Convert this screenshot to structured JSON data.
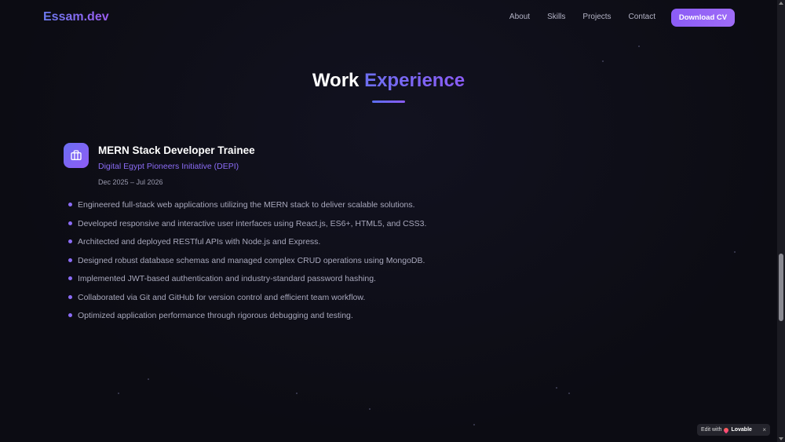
{
  "nav": {
    "logo": "Essam.dev",
    "links": [
      "About",
      "Skills",
      "Projects",
      "Contact"
    ],
    "cta": "Download CV"
  },
  "section": {
    "title_plain": "Work",
    "title_accent": "Experience"
  },
  "experience": {
    "title": "MERN Stack Developer Trainee",
    "company": "Digital Egypt Pioneers Initiative (DEPI)",
    "dates": "Dec 2025 – Jul 2026",
    "icon": "briefcase-icon",
    "bullets": [
      "Engineered full-stack web applications utilizing the MERN stack to deliver scalable solutions.",
      "Developed responsive and interactive user interfaces using React.js, ES6+, HTML5, and CSS3.",
      "Architected and deployed RESTful APIs with Node.js and Express.",
      "Designed robust database schemas and managed complex CRUD operations using MongoDB.",
      "Implemented JWT-based authentication and industry-standard password hashing.",
      "Collaborated via Git and GitHub for version control and efficient team workflow.",
      "Optimized application performance through rigorous debugging and testing."
    ]
  },
  "badge": {
    "prefix": "Edit with",
    "brand": "Lovable",
    "close": "×"
  },
  "colors": {
    "accent": "#8b5cf6",
    "accent_blue": "#6366f1",
    "background": "#0d0d14"
  }
}
